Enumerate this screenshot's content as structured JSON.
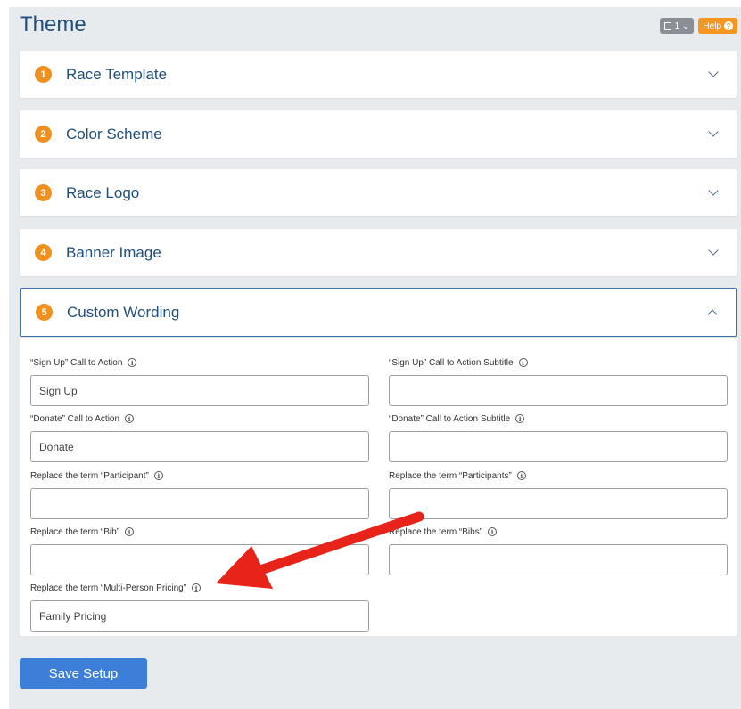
{
  "page": {
    "title": "Theme"
  },
  "top_controls": {
    "doc_count": "1",
    "help_label": "Help"
  },
  "sections": [
    {
      "number": "1",
      "title": "Race Template",
      "expanded": false
    },
    {
      "number": "2",
      "title": "Color Scheme",
      "expanded": false
    },
    {
      "number": "3",
      "title": "Race Logo",
      "expanded": false
    },
    {
      "number": "4",
      "title": "Banner Image",
      "expanded": false
    },
    {
      "number": "5",
      "title": "Custom Wording",
      "expanded": true
    }
  ],
  "custom_wording": {
    "fields": [
      {
        "label": "“Sign Up” Call to Action",
        "value": "Sign Up"
      },
      {
        "label": "“Sign Up” Call to Action Subtitle",
        "value": ""
      },
      {
        "label": "“Donate” Call to Action",
        "value": "Donate"
      },
      {
        "label": "“Donate” Call to Action Subtitle",
        "value": ""
      },
      {
        "label": "Replace the term “Participant”",
        "value": ""
      },
      {
        "label": "Replace the term “Participants”",
        "value": ""
      },
      {
        "label": "Replace the term “Bib”",
        "value": ""
      },
      {
        "label": "Replace the term “Bibs”",
        "value": ""
      },
      {
        "label": "Replace the term “Multi-Person Pricing”",
        "value": "Family Pricing"
      }
    ]
  },
  "actions": {
    "save_label": "Save Setup"
  },
  "colors": {
    "accent": "#f0901e",
    "primary": "#3d7fd8",
    "title": "#1f4f7a",
    "arrow": "#e8231a"
  },
  "icons": {
    "info": "info-icon",
    "chevron": "chevron-icon",
    "help": "question-circle-icon",
    "document": "document-icon"
  }
}
